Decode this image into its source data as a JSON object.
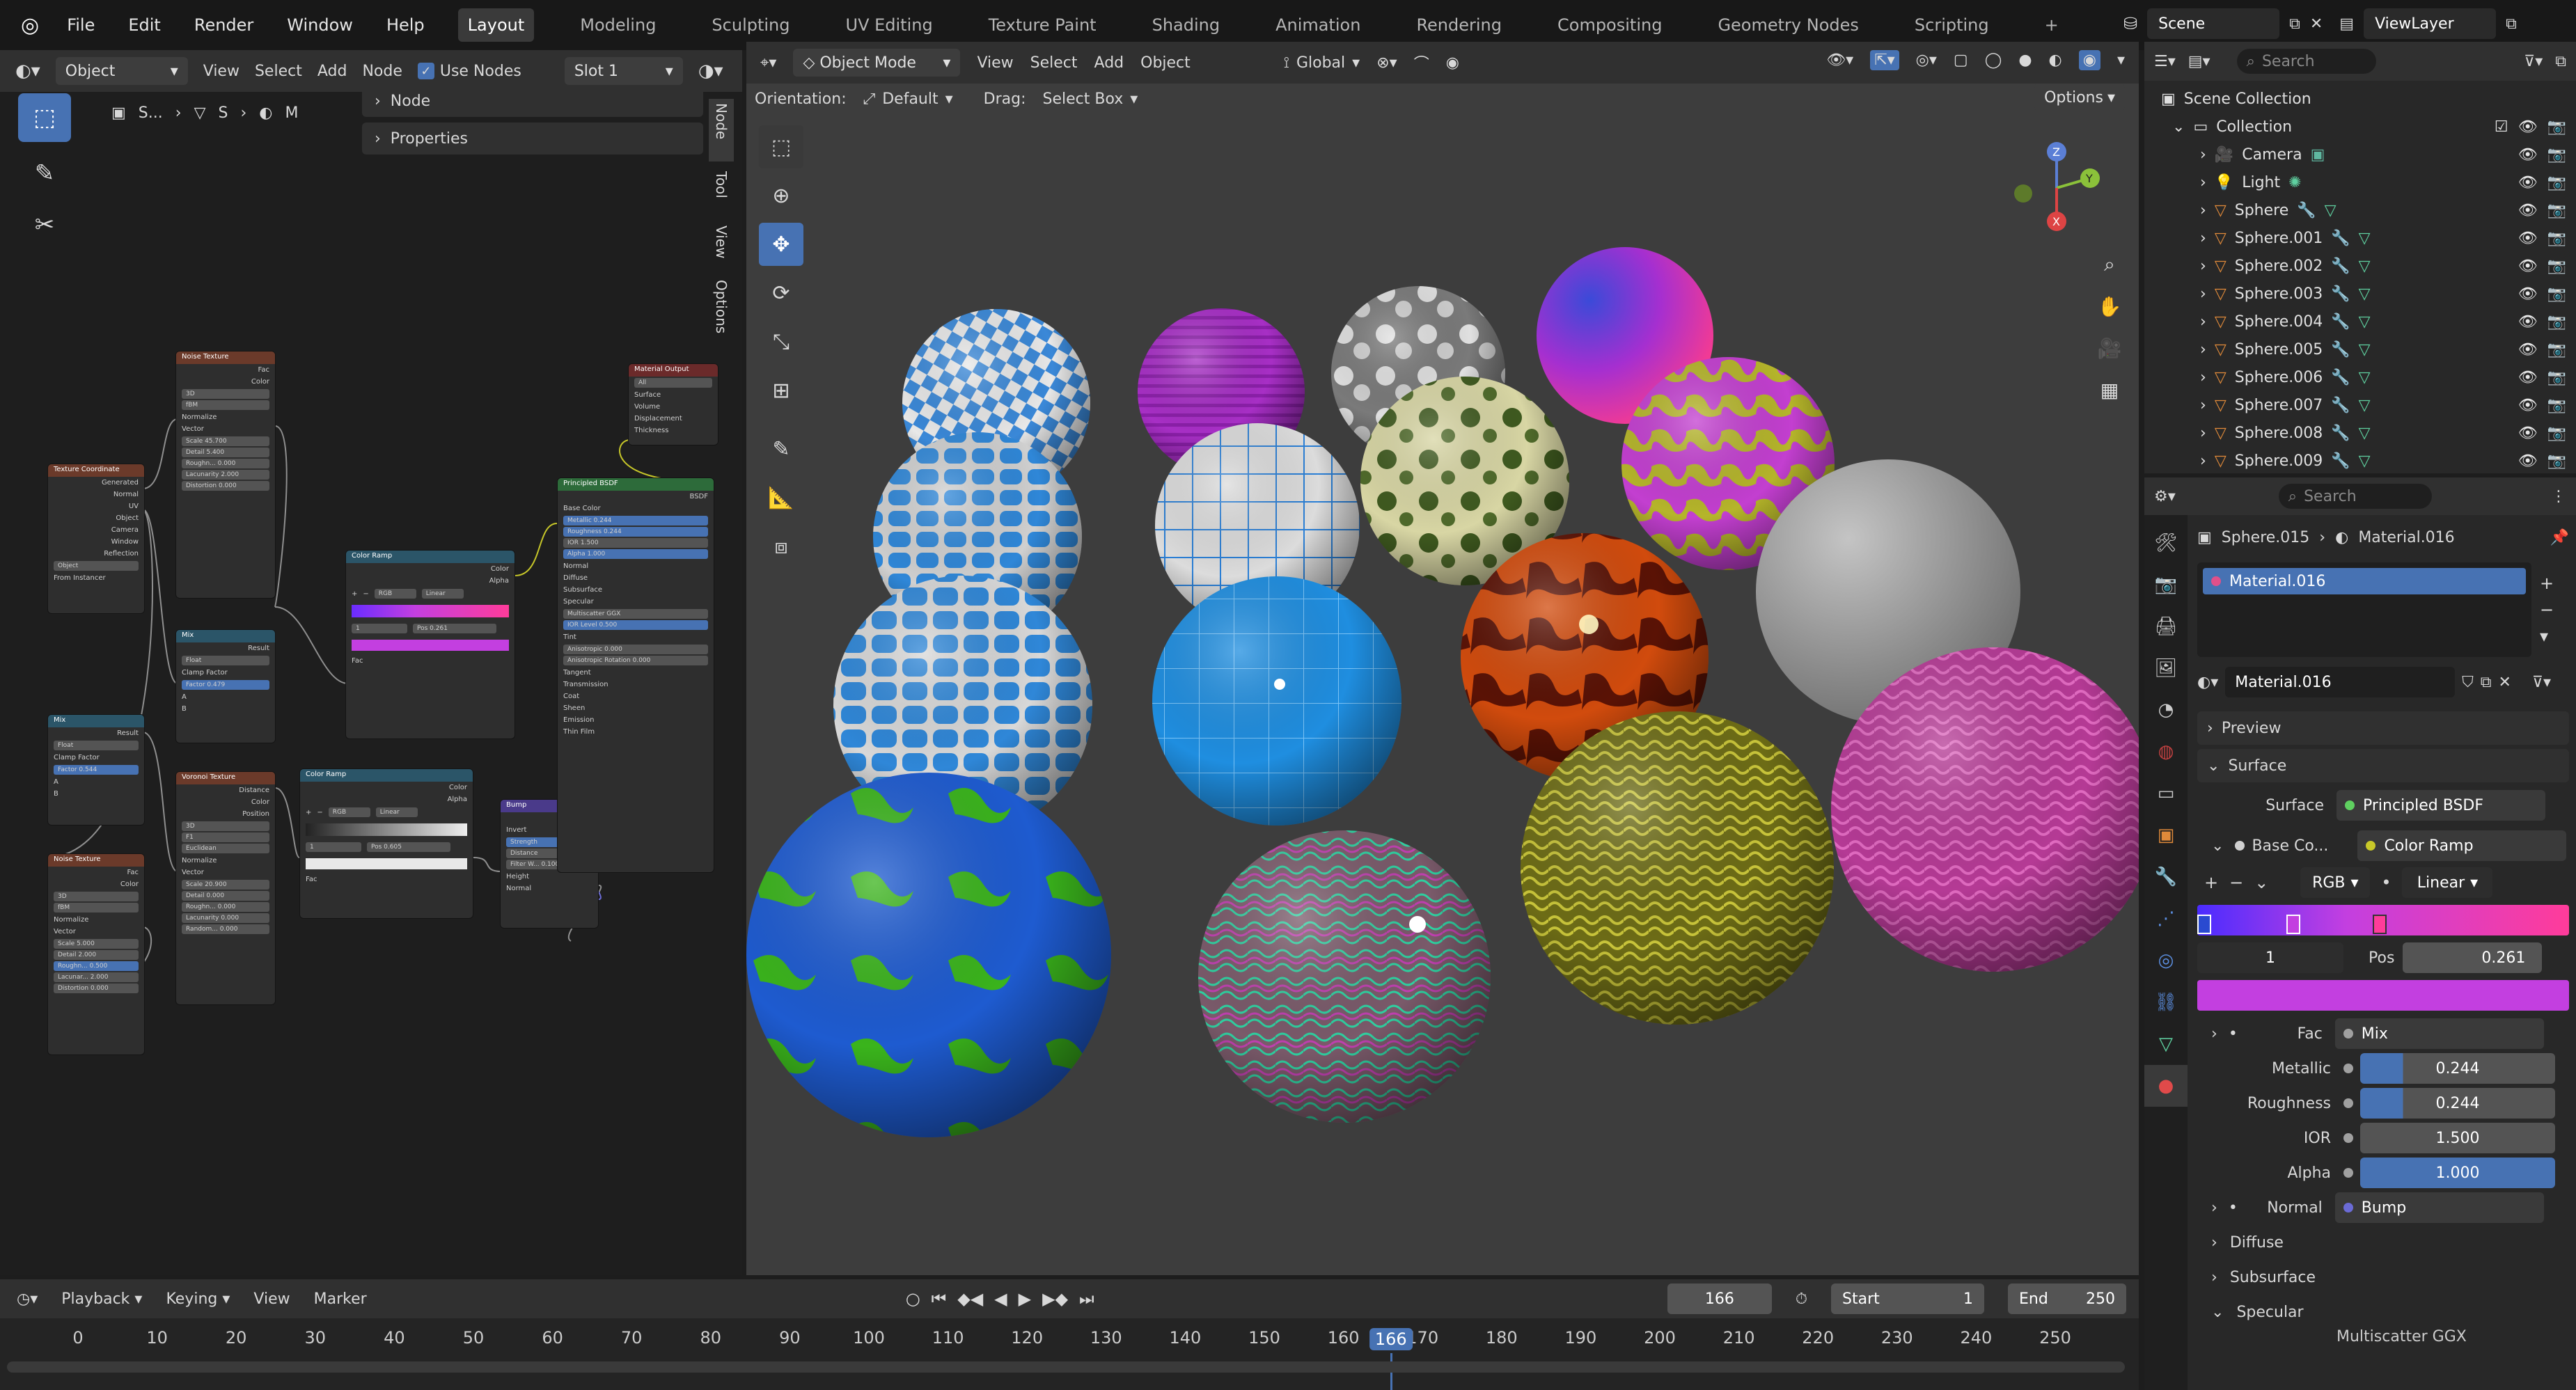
{
  "top_menu": {
    "items": [
      "File",
      "Edit",
      "Render",
      "Window",
      "Help"
    ],
    "workspaces": [
      "Layout",
      "Modeling",
      "Sculpting",
      "UV Editing",
      "Texture Paint",
      "Shading",
      "Animation",
      "Rendering",
      "Compositing",
      "Geometry Nodes",
      "Scripting"
    ],
    "active_workspace": "Layout",
    "add_tab": "+",
    "scene": "Scene",
    "view_layer": "ViewLayer"
  },
  "node_editor": {
    "header": {
      "object_mode": "Object",
      "menus": [
        "View",
        "Select",
        "Add",
        "Node"
      ],
      "use_nodes": "Use Nodes",
      "slot": "Slot 1"
    },
    "breadcrumb": [
      "S...",
      "S",
      "M"
    ],
    "panels": [
      "Node",
      "Properties"
    ],
    "side_tabs": [
      "Node",
      "Tool",
      "View",
      "Options"
    ],
    "nodes": {
      "noise1": {
        "title": "Noise Texture",
        "rows": [
          "Fac",
          "Color",
          "3D",
          "fBM",
          "Normalize",
          "Vector",
          "Scale 45.700",
          "Detail 5.400",
          "Roughn... 0.000",
          "Lacunarity 2.000",
          "Distortion 0.000"
        ]
      },
      "texcoord": {
        "title": "Texture Coordinate",
        "rows": [
          "Generated",
          "Normal",
          "UV",
          "Object",
          "Camera",
          "Window",
          "Reflection",
          "Object",
          "From Instancer"
        ]
      },
      "mix1": {
        "title": "Mix",
        "rows": [
          "Result",
          "Float",
          "Clamp Factor",
          "Factor 0.479",
          "A",
          "B"
        ]
      },
      "mix2": {
        "title": "Mix",
        "rows": [
          "Result",
          "Float",
          "Clamp Factor",
          "Factor 0.544",
          "A",
          "B"
        ]
      },
      "voronoi": {
        "title": "Voronoi Texture",
        "rows": [
          "Distance",
          "Color",
          "Position",
          "3D",
          "F1",
          "Euclidean",
          "Normalize",
          "Vector",
          "Scale 20.900",
          "Detail 0.000",
          "Roughn... 0.000",
          "Lacunarity 0.000",
          "Random... 0.000"
        ]
      },
      "noise2": {
        "title": "Noise Texture",
        "rows": [
          "Fac",
          "Color",
          "3D",
          "fBM",
          "Normalize",
          "Vector",
          "Scale 5.000",
          "Detail 2.000",
          "Roughn... 0.500",
          "Lacunar... 2.000",
          "Distortion 0.000"
        ]
      },
      "ramp1": {
        "title": "Color Ramp",
        "rows": [
          "Color",
          "Alpha",
          "RGB",
          "Linear",
          "1",
          "Pos 0.261",
          "Fac"
        ]
      },
      "ramp2": {
        "title": "Color Ramp",
        "rows": [
          "Color",
          "Alpha",
          "RGB",
          "Linear",
          "1",
          "Pos 0.605",
          "Fac"
        ]
      },
      "bump": {
        "title": "Bump",
        "rows": [
          "Normal",
          "Invert",
          "Strength",
          "Distance",
          "Filter W... 0.100",
          "Height",
          "Normal"
        ]
      },
      "bsdf": {
        "title": "Principled BSDF",
        "rows": [
          "BSDF",
          "Base Color",
          "Metallic 0.244",
          "Roughness 0.244",
          "IOR 1.500",
          "Alpha 1.000",
          "Normal",
          "Diffuse",
          "Subsurface",
          "Specular",
          "Multiscatter GGX",
          "IOR Level 0.500",
          "Tint",
          "Anisotropic 0.000",
          "Anisotropic Rotation 0.000",
          "Tangent",
          "Transmission",
          "Coat",
          "Sheen",
          "Emission",
          "Thin Film"
        ]
      },
      "output": {
        "title": "Material Output",
        "rows": [
          "All",
          "Surface",
          "Volume",
          "Displacement",
          "Thickness"
        ]
      }
    }
  },
  "viewport": {
    "header": {
      "mode": "Object Mode",
      "menus": [
        "View",
        "Select",
        "Add",
        "Object"
      ],
      "transform": "Global"
    },
    "orientation_label": "Orientation:",
    "orientation_value": "Default",
    "drag_label": "Drag:",
    "drag_value": "Select Box",
    "options": "Options",
    "gizmo_axes": [
      "Z",
      "Y",
      "X"
    ]
  },
  "outliner": {
    "search_placeholder": "Search",
    "root": "Scene Collection",
    "collection": "Collection",
    "items": [
      "Camera",
      "Light",
      "Sphere",
      "Sphere.001",
      "Sphere.002",
      "Sphere.003",
      "Sphere.004",
      "Sphere.005",
      "Sphere.006",
      "Sphere.007",
      "Sphere.008",
      "Sphere.009"
    ]
  },
  "properties": {
    "search_placeholder": "Search",
    "object": "Sphere.015",
    "material": "Material.016",
    "slot_material": "Material.016",
    "datablock": "Material.016",
    "sections": {
      "preview": "Preview",
      "surface": "Surface"
    },
    "surface_label": "Surface",
    "surface_value": "Principled BSDF",
    "base_color_label": "Base Co...",
    "base_color_value": "Color Ramp",
    "ramp_mode": "RGB",
    "ramp_interp": "Linear",
    "ramp_index": "1",
    "pos_label": "Pos",
    "pos_value": "0.261",
    "fac_label": "Fac",
    "fac_value": "Mix",
    "metallic_label": "Metallic",
    "metallic_value": "0.244",
    "roughness_label": "Roughness",
    "roughness_value": "0.244",
    "ior_label": "IOR",
    "ior_value": "1.500",
    "alpha_label": "Alpha",
    "alpha_value": "1.000",
    "normal_label": "Normal",
    "normal_value": "Bump",
    "subpanels": [
      "Diffuse",
      "Subsurface",
      "Specular"
    ],
    "cut_off": "Multiscatter GGX"
  },
  "timeline": {
    "menus": [
      "Playback",
      "Keying",
      "View",
      "Marker"
    ],
    "current_frame": "166",
    "start_label": "Start",
    "start_value": "1",
    "end_label": "End",
    "end_value": "250",
    "ticks": [
      "0",
      "10",
      "20",
      "30",
      "40",
      "50",
      "60",
      "70",
      "80",
      "90",
      "100",
      "110",
      "120",
      "130",
      "140",
      "150",
      "160",
      "166",
      "170",
      "180",
      "190",
      "200",
      "210",
      "220",
      "230",
      "240",
      "250"
    ]
  },
  "colors": {
    "accent": "#4772b3",
    "ramp_start": "#6a2cff",
    "ramp_end": "#ff3c9a",
    "selected_color": "#c33fe0"
  }
}
